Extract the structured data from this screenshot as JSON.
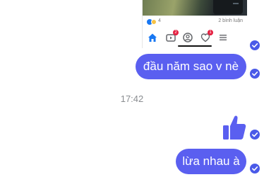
{
  "shared_post": {
    "reaction_count": "4",
    "comment_count": "2 bình luận",
    "nav_badges": {
      "watch": "2",
      "notifications": "1"
    }
  },
  "messages": [
    {
      "text": "đầu năm sao v nè",
      "sender": "me"
    },
    {
      "text": "lừa nhau à",
      "sender": "me"
    }
  ],
  "timestamp": "17:42",
  "thumbs_up_sticker": "thumbs-up-icon",
  "colors": {
    "bubble": "#5a5ff0",
    "seen_receipt": "#4a5ae8",
    "timestamp_text": "#8a8d91"
  }
}
